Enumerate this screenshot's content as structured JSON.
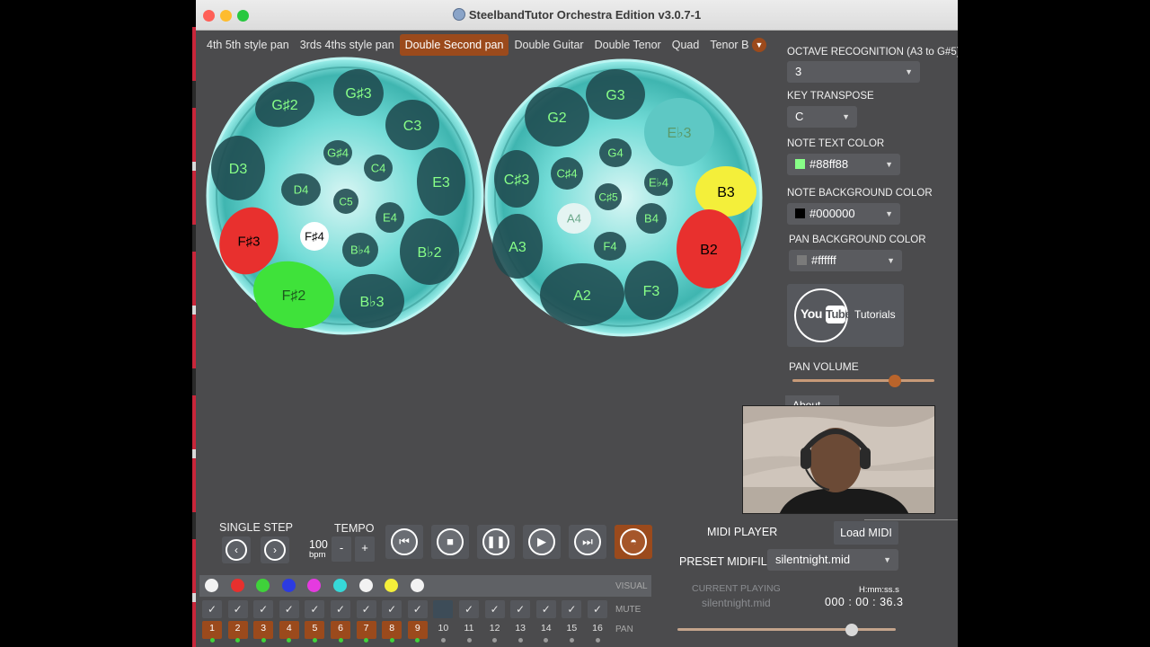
{
  "window": {
    "title": "SteelbandTutor Orchestra Edition v3.0.7-1"
  },
  "tabs": [
    {
      "label": "4th 5th style pan",
      "active": false
    },
    {
      "label": "3rds 4ths style pan",
      "active": false
    },
    {
      "label": "Double Second pan",
      "active": true
    },
    {
      "label": "Double Guitar",
      "active": false
    },
    {
      "label": "Double Tenor",
      "active": false
    },
    {
      "label": "Quad",
      "active": false
    },
    {
      "label": "Tenor Bas",
      "active": false
    }
  ],
  "tabs_more_icon": "chevron-down-icon",
  "pans": {
    "left": [
      {
        "note": "G♯2",
        "fill": "#1f4a4e",
        "text": "#88ff88"
      },
      {
        "note": "G♯3",
        "fill": "#1f4a4e",
        "text": "#88ff88"
      },
      {
        "note": "C3",
        "fill": "#1f4a4e",
        "text": "#88ff88"
      },
      {
        "note": "D3",
        "fill": "#1f4a4e",
        "text": "#88ff88"
      },
      {
        "note": "G♯4",
        "fill": "#1f4a4e",
        "text": "#88ff88"
      },
      {
        "note": "C4",
        "fill": "#1f4a4e",
        "text": "#88ff88"
      },
      {
        "note": "E3",
        "fill": "#1f4a4e",
        "text": "#88ff88"
      },
      {
        "note": "D4",
        "fill": "#1f4a4e",
        "text": "#88ff88"
      },
      {
        "note": "C5",
        "fill": "#1f4a4e",
        "text": "#88ff88"
      },
      {
        "note": "E4",
        "fill": "#1f4a4e",
        "text": "#88ff88"
      },
      {
        "note": "F♯3",
        "fill": "#e8302e",
        "text": "#000000"
      },
      {
        "note": "F♯4",
        "fill": "#ffffff",
        "text": "#000000"
      },
      {
        "note": "B♭4",
        "fill": "#1f4a4e",
        "text": "#88ff88"
      },
      {
        "note": "B♭2",
        "fill": "#1f4a4e",
        "text": "#88ff88"
      },
      {
        "note": "F♯2",
        "fill": "#3fe23a",
        "text": "#1d5a1d"
      },
      {
        "note": "B♭3",
        "fill": "#1f4a4e",
        "text": "#88ff88"
      }
    ],
    "right": [
      {
        "note": "G3",
        "fill": "#1f4a4e",
        "text": "#88ff88"
      },
      {
        "note": "G2",
        "fill": "#1f4a4e",
        "text": "#88ff88"
      },
      {
        "note": "E♭3",
        "fill": "#5ec8c4",
        "text": "#5a9a6a"
      },
      {
        "note": "G4",
        "fill": "#1f4a4e",
        "text": "#88ff88"
      },
      {
        "note": "C♯3",
        "fill": "#1f4a4e",
        "text": "#88ff88"
      },
      {
        "note": "C♯4",
        "fill": "#1f4a4e",
        "text": "#88ff88"
      },
      {
        "note": "E♭4",
        "fill": "#1f4a4e",
        "text": "#88ff88"
      },
      {
        "note": "B3",
        "fill": "#f4ef3a",
        "text": "#000000"
      },
      {
        "note": "C♯5",
        "fill": "#1f4a4e",
        "text": "#88ff88"
      },
      {
        "note": "A4",
        "fill": "#e4f4f2",
        "text": "#6aa88a"
      },
      {
        "note": "B4",
        "fill": "#1f4a4e",
        "text": "#88ff88"
      },
      {
        "note": "A3",
        "fill": "#1f4a4e",
        "text": "#88ff88"
      },
      {
        "note": "F4",
        "fill": "#1f4a4e",
        "text": "#88ff88"
      },
      {
        "note": "B2",
        "fill": "#e8302e",
        "text": "#000000"
      },
      {
        "note": "A2",
        "fill": "#1f4a4e",
        "text": "#88ff88"
      },
      {
        "note": "F3",
        "fill": "#1f4a4e",
        "text": "#88ff88"
      }
    ]
  },
  "side": {
    "octave_label": "OCTAVE RECOGNITION (A3 to G#5)",
    "octave_value": "3",
    "transpose_label": "KEY TRANSPOSE",
    "transpose_value": "C",
    "text_color_label": "NOTE TEXT COLOR",
    "text_color_value": "#88ff88",
    "bg_color_label": "NOTE BACKGROUND COLOR",
    "bg_color_value": "#000000",
    "pan_bg_label": "PAN BACKGROUND COLOR",
    "pan_bg_value": "#ffffff",
    "youtube_you": "You",
    "youtube_tube": "Tube",
    "tutorials": "Tutorials",
    "volume_label": "PAN VOLUME",
    "volume_level": 0.72,
    "about_label": "About"
  },
  "transport": {
    "single_step": "SINGLE STEP",
    "tempo": "TEMPO",
    "bpm": "100",
    "bpm_unit": "bpm",
    "minus": "-",
    "plus": "+",
    "icons": [
      "skip-back-icon",
      "stop-icon",
      "pause-icon",
      "play-icon",
      "skip-forward-icon",
      "steelpan-icon"
    ]
  },
  "midi": {
    "player_label": "MIDI PLAYER",
    "load_label": "Load MIDI",
    "preset_label": "PRESET MIDIFILES",
    "preset_value": "silentnight.mid",
    "current_label": "CURRENT PLAYING",
    "current_file": "silentnight.mid",
    "hms_label": "H:mm:ss.s",
    "time": "000 : 00 : 36.3",
    "position": 0.8
  },
  "mixer": {
    "visual_label": "VISUAL",
    "mute_label": "MUTE",
    "pan_label": "PAN",
    "dot_colors": [
      "#f2f2f2",
      "#e8302e",
      "#3fd23a",
      "#2c3be0",
      "#e53ae0",
      "#36d8d8",
      "#f2f2f2",
      "#f4ef3a",
      "#f2f2f2"
    ],
    "mute": [
      true,
      true,
      true,
      true,
      true,
      true,
      true,
      true,
      true,
      false,
      true,
      true,
      true,
      true,
      true,
      true
    ],
    "pans": [
      "1",
      "2",
      "3",
      "4",
      "5",
      "6",
      "7",
      "8",
      "9",
      "10",
      "11",
      "12",
      "13",
      "14",
      "15",
      "16"
    ],
    "pan_active": 9
  },
  "colors": {
    "accent": "#9b4a1c",
    "panel": "#4b4b4d",
    "button": "#55575c",
    "pan_glow": "#4fe0dc"
  }
}
